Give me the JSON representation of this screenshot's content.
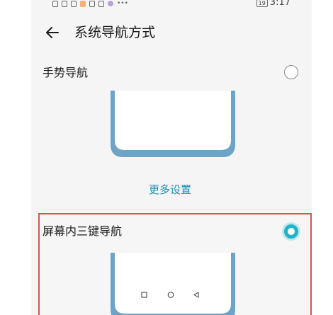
{
  "status_bar": {
    "battery": "19",
    "time": "3:17"
  },
  "header": {
    "title": "系统导航方式"
  },
  "options": [
    {
      "label": "手势导航",
      "selected": false
    },
    {
      "label": "屏幕内三键导航",
      "selected": true
    }
  ],
  "more_settings_label": "更多设置",
  "colors": {
    "accent": "#1fb5c9",
    "link": "#1c8fb3",
    "phone_frame": "#6ca3c7",
    "selection_border": "#d9534f"
  },
  "icons": {
    "back": "arrow-left-icon",
    "nav_buttons": [
      "square-icon",
      "circle-icon",
      "triangle-left-icon"
    ]
  }
}
